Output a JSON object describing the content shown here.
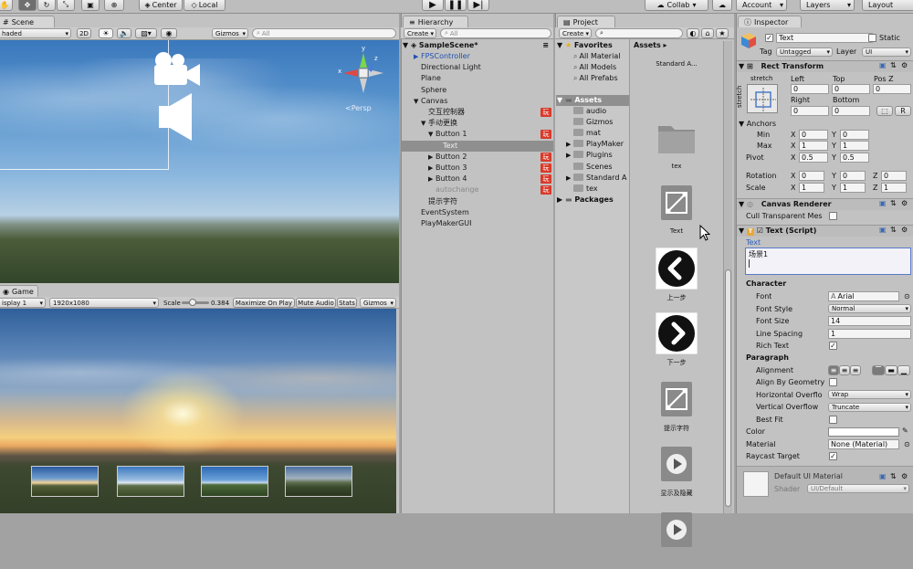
{
  "toolbar": {
    "pivot_label": "Center",
    "space_label": "Local",
    "collab_label": "Collab",
    "account_label": "Account",
    "layers_label": "Layers",
    "layout_label": "Layout"
  },
  "scene": {
    "tab_label": "Scene",
    "shading_mode": "haded",
    "mode_2d": "2D",
    "gizmos_label": "Gizmos",
    "search_placeholder": "All",
    "persp_label": "<Persp",
    "gizmo_axis_y": "y",
    "gizmo_axis_x": "x",
    "gizmo_axis_z": "z"
  },
  "game": {
    "tab_label": "Game",
    "display": "isplay 1",
    "resolution": "1920x1080",
    "scale_label": "Scale",
    "scale_value": "0.384",
    "scale_fraction": 0.384,
    "maximize_label": "Maximize On Play",
    "mute_label": "Mute Audio",
    "stats_label": "Stats",
    "gizmos_label": "Gizmos"
  },
  "hierarchy": {
    "tab_label": "Hierarchy",
    "create_label": "Create",
    "search_placeholder": "All",
    "scene_name": "SampleScene*",
    "items": [
      {
        "label": "FPSController",
        "indent": 1,
        "arrow": "▶",
        "color": "#2150b0",
        "badge": ""
      },
      {
        "label": "Directional Light",
        "indent": 1,
        "arrow": "",
        "color": "#1a1a1a",
        "badge": ""
      },
      {
        "label": "Plane",
        "indent": 1,
        "arrow": "",
        "color": "#1a1a1a",
        "badge": ""
      },
      {
        "label": "Sphere",
        "indent": 1,
        "arrow": "",
        "color": "#1a1a1a",
        "badge": ""
      },
      {
        "label": "Canvas",
        "indent": 1,
        "arrow": "▼",
        "color": "#1a1a1a",
        "badge": ""
      },
      {
        "label": "交互控制器",
        "indent": 2,
        "arrow": "",
        "color": "#1a1a1a",
        "badge": "玩"
      },
      {
        "label": "手动更换",
        "indent": 2,
        "arrow": "▼",
        "color": "#1a1a1a",
        "badge": ""
      },
      {
        "label": "Button 1",
        "indent": 3,
        "arrow": "▼",
        "color": "#1a1a1a",
        "badge": "玩"
      },
      {
        "label": "Text",
        "indent": 4,
        "arrow": "",
        "color": "#f0f0f0",
        "badge": "",
        "selected": true
      },
      {
        "label": "Button 2",
        "indent": 3,
        "arrow": "▶",
        "color": "#1a1a1a",
        "badge": "玩"
      },
      {
        "label": "Button 3",
        "indent": 3,
        "arrow": "▶",
        "color": "#1a1a1a",
        "badge": "玩"
      },
      {
        "label": "Button 4",
        "indent": 3,
        "arrow": "▶",
        "color": "#1a1a1a",
        "badge": "玩"
      },
      {
        "label": "autochange",
        "indent": 3,
        "arrow": "",
        "color": "#8a8a8a",
        "badge": "玩"
      },
      {
        "label": "提示字符",
        "indent": 2,
        "arrow": "",
        "color": "#1a1a1a",
        "badge": ""
      },
      {
        "label": "EventSystem",
        "indent": 1,
        "arrow": "",
        "color": "#1a1a1a",
        "badge": ""
      },
      {
        "label": "PlayMakerGUI",
        "indent": 1,
        "arrow": "",
        "color": "#1a1a1a",
        "badge": ""
      }
    ]
  },
  "project": {
    "tab_label": "Project",
    "create_label": "Create",
    "favorites_label": "Favorites",
    "favorites": [
      "All Material",
      "All Models",
      "All Prefabs"
    ],
    "assets_label": "Assets",
    "folders": [
      {
        "label": "audio",
        "arrow": ""
      },
      {
        "label": "Gizmos",
        "arrow": ""
      },
      {
        "label": "mat",
        "arrow": ""
      },
      {
        "label": "PlayMaker",
        "arrow": "▶"
      },
      {
        "label": "Plugins",
        "arrow": "▶"
      },
      {
        "label": "Scenes",
        "arrow": ""
      },
      {
        "label": "Standard A",
        "arrow": "▶"
      },
      {
        "label": "tex",
        "arrow": ""
      }
    ],
    "packages_label": "Packages",
    "breadcrumb": "Assets ▸",
    "grid_items": [
      {
        "label": "Standard A...",
        "icon": "none"
      },
      {
        "label": "tex",
        "icon": "folder"
      },
      {
        "label": "Text",
        "icon": "prefab"
      },
      {
        "label": "上一步",
        "icon": "left"
      },
      {
        "label": "下一步",
        "icon": "right"
      },
      {
        "label": "提示字符",
        "icon": "prefab"
      },
      {
        "label": "显示及隐藏",
        "icon": "play"
      },
      {
        "label": "",
        "icon": "play"
      }
    ]
  },
  "inspector": {
    "tab_label": "Inspector",
    "object_name": "Text",
    "static_label": "Static",
    "tag_label": "Tag",
    "tag_value": "Untagged",
    "layer_label": "Layer",
    "layer_value": "UI",
    "rect_transform": {
      "title": "Rect Transform",
      "stretch_label": "stretch",
      "left_label": "Left",
      "top_label": "Top",
      "posz_label": "Pos Z",
      "left": "0",
      "top": "0",
      "posz": "0",
      "right_label": "Right",
      "bottom_label": "Bottom",
      "right": "0",
      "bottom": "0",
      "r_label": "R",
      "anchors_label": "Anchors",
      "min_label": "Min",
      "max_label": "Max",
      "pivot_label": "Pivot",
      "min_x": "0",
      "min_y": "0",
      "max_x": "1",
      "max_y": "1",
      "pivot_x": "0.5",
      "pivot_y": "0.5",
      "rotation_label": "Rotation",
      "scale_label": "Scale",
      "rot_x": "0",
      "rot_y": "0",
      "rot_z": "0",
      "scale_x": "1",
      "scale_y": "1",
      "scale_z": "1",
      "x": "X",
      "y": "Y",
      "z": "Z"
    },
    "canvas_renderer": {
      "title": "Canvas Renderer",
      "cull_label": "Cull Transparent Mes"
    },
    "text_script": {
      "title": "Text (Script)",
      "text_label": "Text",
      "text_value": "场景1",
      "character_label": "Character",
      "font_label": "Font",
      "font_value": "Arial",
      "font_style_label": "Font Style",
      "font_style_value": "Normal",
      "font_size_label": "Font Size",
      "font_size_value": "14",
      "line_spacing_label": "Line Spacing",
      "line_spacing_value": "1",
      "rich_text_label": "Rich Text",
      "paragraph_label": "Paragraph",
      "alignment_label": "Alignment",
      "align_geometry_label": "Align By Geometry",
      "h_overflow_label": "Horizontal Overflo",
      "h_overflow_value": "Wrap",
      "v_overflow_label": "Vertical Overflow",
      "v_overflow_value": "Truncate",
      "best_fit_label": "Best Fit",
      "color_label": "Color",
      "material_label": "Material",
      "material_value": "None (Material)",
      "raycast_label": "Raycast Target"
    },
    "material_preview": {
      "title": "Default UI Material",
      "shader_label": "Shader",
      "shader_value": "UI/Default"
    }
  },
  "colors": {
    "accent": "#3a72d8",
    "badge": "#d83a2a",
    "selection": "#8f8f8f"
  }
}
